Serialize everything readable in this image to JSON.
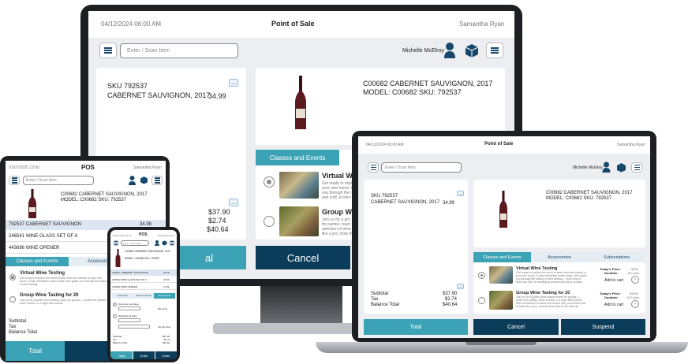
{
  "monitor": {
    "datetime": "04/12/2024 06:00 AM",
    "title": "Point of Sale",
    "user": "Samantha Ryan",
    "search_placeholder": "Enter / Scan Item",
    "customer": "Michelle McElroy",
    "item_sku_line": "SKU 792537",
    "item_name": "CABERNET SAUVIGNON, 2017",
    "item_price": "34.99",
    "product_line1": "C00682 CABERNET SAUVIGNON, 2017",
    "product_line2": "MODEL: C00682 SKU: 792537",
    "tab_classes": "Classes and Events",
    "event1_title": "Virtual Wine",
    "event1_desc": "Get ready to expl your own home. I you through the t and sniff, to iden",
    "event2_title": "Group Wine",
    "event2_desc": "Join us for a gro for parties, team selection of wine like a pro, from th",
    "subtotal": "$37.90",
    "tax": "$2.74",
    "balance": "$40.64",
    "total_label": "al",
    "cancel_label": "Cancel",
    "more_label": "..."
  },
  "laptop": {
    "datetime": "04/12/2024 06:00 AM",
    "title": "Point of Sale",
    "user": "Samantha Ryan",
    "search_placeholder": "Enter / Scan Item",
    "customer": "Michelle McElroy",
    "item_sku_line": "SKU 792537",
    "item_name": "CABERNET SAUVIGNON, 2017",
    "item_price": "34.99",
    "product_line1": "C00682 CABERNET SAUVIGNON, 2017",
    "product_line2": "MODEL: C00682 SKU: 792537",
    "tabs": [
      "Classes and Events",
      "Accessories",
      "Subscriptions"
    ],
    "events": [
      {
        "title": "Virtual Wine Testing",
        "desc": "Get ready to explore the world of wine from the comfort of your own home. In this interactive online class, we'll guide you through the basics of wine tasting — from how to swirl and sniff, to identifying aromas and flavor profiles.",
        "price_label": "Today's Price:",
        "price": "$150",
        "duration_label": "Duration:",
        "duration": "60 mins",
        "cart": "Add to cart"
      },
      {
        "title": "Group Wine Tasting for 20",
        "desc": "Join us for a guided wine tasting made for groups — perfect for parties, team events, or a night with friends. With a selection of wines and expert tips, you'll learn how to taste like a pro, from the first swirl to the final sip.",
        "price_label": "Today's Price:",
        "price": "$1500",
        "duration_label": "Duration:",
        "duration": "120 mins",
        "cart": "Add to cart"
      }
    ],
    "subtotal_label": "Subtotal",
    "tax_label": "Tax",
    "balance_label": "Balance Total",
    "subtotal": "$37.90",
    "tax": "$2.74",
    "balance": "$40.64",
    "total_label": "Total",
    "cancel_label": "Cancel",
    "suspend_label": "Suspend",
    "more_label": "..."
  },
  "tablet": {
    "datetime": "01/07/2025 13:00",
    "title": "POS",
    "user": "Samantha Ryan",
    "search_placeholder": "Enter / Scan Item",
    "product_line1": "C00682 CABERNET SAUVIGNON, 2017",
    "product_line2": "MODEL: C00682 SKU: 792537",
    "lines": [
      {
        "name": "792537 CABERNET SAUVIGNON",
        "price": "34.99"
      },
      {
        "name": "246541 WINE GLASS SET OF 6",
        "price": ""
      },
      {
        "name": "443696 WINE OPENER",
        "price": ""
      }
    ],
    "tabs": [
      "Classes and Events",
      "Accessories"
    ],
    "events": [
      {
        "title": "Virtual Wine Testing",
        "desc": "Get ready to explore the world of wine from the comfort of your own home. In this interactive online class, we'll guide you through the basics of wine tasting."
      },
      {
        "title": "Group Wine Tasting for 20",
        "desc": "Join us for a guided wine tasting made for groups — perfect for parties, team events, or a night with friends."
      }
    ],
    "subtotal_label": "Subtotal",
    "tax_label": "Tax",
    "balance_label": "Balance Total",
    "total_label": "Total",
    "enter_label": "Enter"
  },
  "phone": {
    "datetime": "01/07/2025 13:00",
    "title": "POS",
    "user": "Samantha Ryan",
    "search_placeholder": "Enter / Scan Item",
    "product_line1": "C00682 CABERNET SAUVIGNON, 2017",
    "product_line2": "MODEL: C00682 SKU: 792537",
    "lines": [
      {
        "name": "792537 CABERNET SAUVIGNON",
        "price": "34.99"
      },
      {
        "name": "246541 WINE GLASS SET OF 6",
        "price": "44.99"
      },
      {
        "name": "443696 WINE OPENER",
        "price": "11.99"
      }
    ],
    "tabs": [
      "Extensions",
      "Classes & Events",
      "Subscriptions"
    ],
    "option1": "One-time purchase",
    "option2": "Subscribe & Save",
    "buy_now": "Buy Now",
    "set_up_now": "Set Up Now",
    "subtotal_label": "Subtotal",
    "tax_label": "Tax",
    "balance_label": "Balance Total",
    "subtotal": "$37.90",
    "tax": "$2.74",
    "balance": "$40.64",
    "total_label": "Total",
    "enter_label": "Enter",
    "order_label": "Order"
  },
  "colors": {
    "teal": "#3ba3b5",
    "navy": "#0b3d5b",
    "wine": "#5a1a20"
  }
}
